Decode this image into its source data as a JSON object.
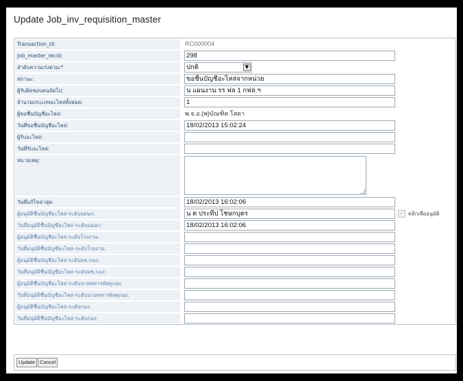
{
  "title": "Update Job_inv_requisition_master",
  "rows": [
    {
      "label": "Transaction_id:",
      "value": "RC000004"
    },
    {
      "label": "Job_master_recid:",
      "value": "298"
    },
    {
      "label": "ลำดับความเร่งด่วน:*",
      "value": "ปกติ"
    },
    {
      "label": "สถานะ:",
      "value": "ขอชื่นบัญชีอะไหล่จากหน่วย"
    },
    {
      "label": "ผู้รับผิดชอบคนถัดไป:",
      "value": "น แผนงาน รร ฟล 1 กฟล.ฯ"
    },
    {
      "label": "จำนวนประเภทอะไหล่ทั้งหมด:",
      "value": "1"
    },
    {
      "label": "ผู้ขอชื่นบัญชีอะไหล่:",
      "value": "พ.จ.อ.(พ)บัณฑิต โสดา"
    },
    {
      "label": "วันที่ขอชื่นบัญชีอะไหล่:",
      "value": "18/02/2013 15:02:24"
    },
    {
      "label": "ผู้รับอะไหล่:",
      "value": ""
    },
    {
      "label": "วันที่รับอะไหล่:",
      "value": ""
    },
    {
      "label": "หมายเหตุ:",
      "value": ""
    },
    {
      "label": "วันที่แก้ไขล่าสุด:",
      "value": "18/02/2013 16:02:06"
    },
    {
      "label": "ผู้อนุมัติชื่นบัญชีอะไหล่-ระดับแผนก:",
      "value": "น ต ประทีป  โชษกบุตร"
    },
    {
      "label": "วันที่อนุมัติชื่นบัญชีอะไหล่-ระดับแผนก:",
      "value": "18/02/2013 16:02:06"
    },
    {
      "label": "ผู้อนุมัติชื่นบัญชีอะไหล่-ระดับโรงงาน:",
      "value": ""
    },
    {
      "label": "วันที่อนุมัติชื่นบัญชีอะไหล่-ระดับโรงงาน:",
      "value": ""
    },
    {
      "label": "ผู้อนุมัติชื่นบัญชีอะไหล่-ระดับผช.กอง:",
      "value": ""
    },
    {
      "label": "วันที่อนุมัติชื่นบัญชีอะไหล่-ระดับผช.กอง:",
      "value": ""
    },
    {
      "label": "ผู้อนุมัติชื่นบัญชีอะไหล่-ระดับนายทหารพัสดุกอง:",
      "value": ""
    },
    {
      "label": "วันที่อนุมัติชื่นบัญชีอะไหล่-ระดับนายทหารพัสดุกอง:",
      "value": ""
    },
    {
      "label": "ผู้อนุมัติชื่นบัญชีอะไหล่-ระดับกอง:",
      "value": ""
    },
    {
      "label": "วันที่อนุมัติชื่นบัญชีอะไหล่-ระดับกอง:",
      "value": ""
    }
  ],
  "approve_checkbox_label": "คลิกเพื่ออนุมัติ",
  "buttons": {
    "update": "Update",
    "cancel": "Cancel"
  }
}
